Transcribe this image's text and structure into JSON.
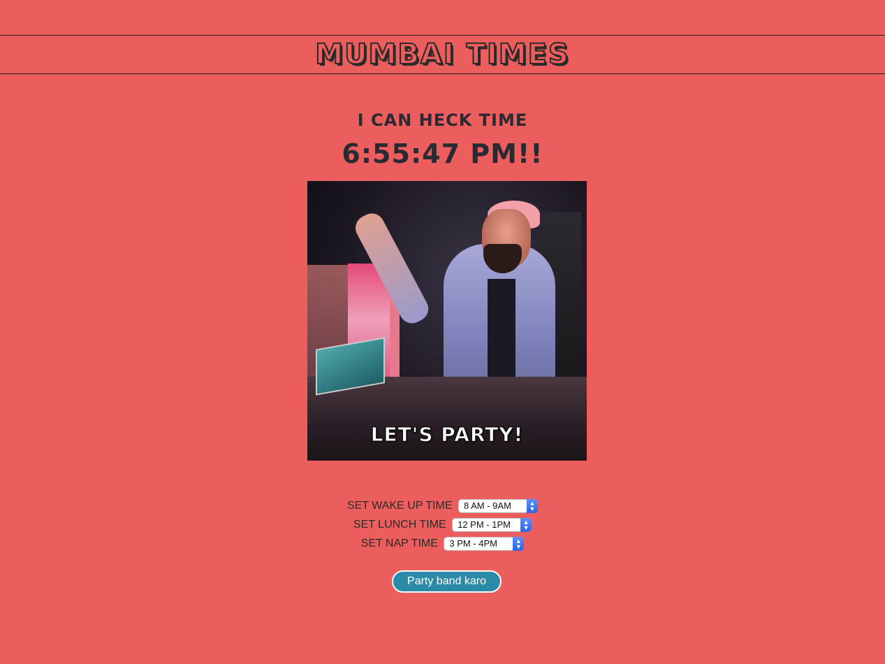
{
  "header": {
    "brand": "MUMBAI TIMES"
  },
  "main": {
    "heading": "I CAN HECK TIME",
    "clock": "6:55:47 PM!!",
    "image": {
      "caption": "LET'S PARTY!"
    }
  },
  "settings": [
    {
      "label": "SET WAKE UP TIME",
      "selected": "8 AM - 9AM"
    },
    {
      "label": "SET LUNCH TIME",
      "selected": "12 PM - 1PM"
    },
    {
      "label": "SET NAP TIME",
      "selected": "3 PM - 4PM"
    }
  ],
  "action": {
    "button_label": "Party band karo"
  },
  "colors": {
    "background": "#ec5e5e",
    "button": "#2b8aa8",
    "select_accent": "#2a65e8"
  },
  "icons": {
    "select_arrows": "chevron-up-down-icon"
  }
}
